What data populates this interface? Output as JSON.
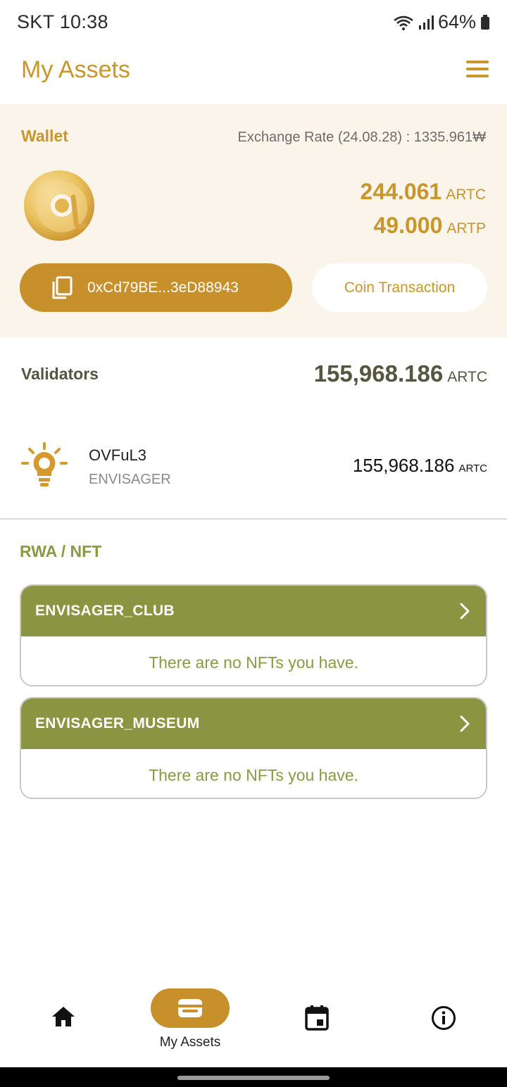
{
  "status_bar": {
    "carrier_time": "SKT 10:38",
    "battery": "64%"
  },
  "header": {
    "title": "My Assets",
    "menu_icon": "hamburger-menu-icon"
  },
  "wallet": {
    "label": "Wallet",
    "exchange_rate": "Exchange Rate (24.08.28) : 1335.961₩",
    "balances": [
      {
        "amount": "244.061",
        "unit": "ARTC"
      },
      {
        "amount": "49.000",
        "unit": "ARTP"
      }
    ],
    "address": "0xCd79BE...3eD88943",
    "coin_transaction_label": "Coin Transaction"
  },
  "validators": {
    "label": "Validators",
    "total_amount": "155,968.186",
    "total_unit": "ARTC",
    "items": [
      {
        "name": "OVFuL3",
        "subtitle": "ENVISAGER",
        "amount": "155,968.186",
        "unit": "ARTC"
      }
    ]
  },
  "rwa_nft": {
    "label": "RWA / NFT",
    "collections": [
      {
        "name": "ENVISAGER_CLUB",
        "empty_text": "There are no NFTs you have."
      },
      {
        "name": "ENVISAGER_MUSEUM",
        "empty_text": "There are no NFTs you have."
      }
    ]
  },
  "bottom_nav": {
    "items": [
      {
        "icon": "home-icon",
        "label": ""
      },
      {
        "icon": "wallet-icon",
        "label": "My Assets",
        "active": true
      },
      {
        "icon": "calendar-icon",
        "label": ""
      },
      {
        "icon": "info-icon",
        "label": ""
      }
    ]
  },
  "colors": {
    "accent_gold": "#c8962a",
    "olive": "#8b9441",
    "wallet_bg": "#faf4ea"
  }
}
